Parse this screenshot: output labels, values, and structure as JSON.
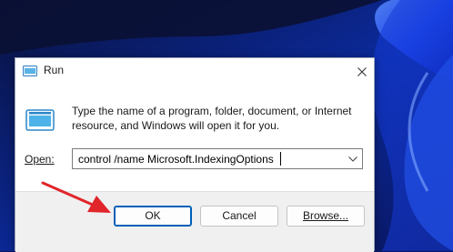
{
  "dialog": {
    "title": "Run",
    "description": "Type the name of a program, folder, document, or Internet resource, and Windows will open it for you.",
    "open_label": "Open:",
    "open_value": "control /name Microsoft.IndexingOptions",
    "buttons": {
      "ok": "OK",
      "cancel": "Cancel",
      "browse": "Browse..."
    }
  },
  "icons": {
    "title": "run-icon",
    "program": "run-program-icon",
    "close": "close-icon",
    "dropdown": "chevron-down-icon",
    "annotation": "red-arrow-icon"
  },
  "colors": {
    "accent": "#005fb8",
    "annotation_arrow": "#e0262b",
    "wallpaper": "#0a1a6b"
  }
}
